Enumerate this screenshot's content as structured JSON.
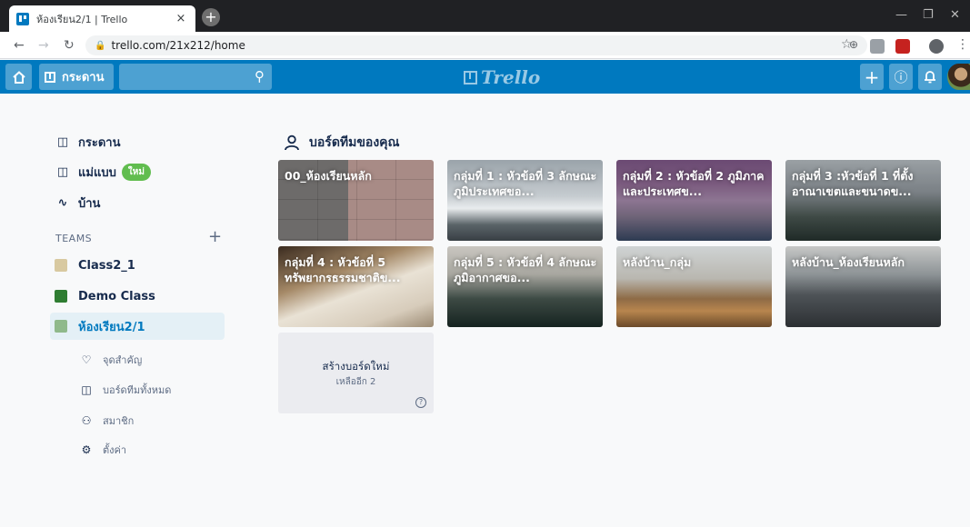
{
  "browser": {
    "tab_title": "ห้องเรียน2/1 | Trello",
    "tab_close": "×",
    "new_tab": "+",
    "url": "trello.com/21x212/home",
    "window_controls": {
      "minimize": "—",
      "restore": "❐",
      "close": "✕"
    }
  },
  "header": {
    "home_icon": "home-icon",
    "boards_label": "กระดาน",
    "search_value": "",
    "logo_text": "Trello",
    "add_label": "+",
    "info_label": "ⓘ",
    "accent": "#0079bf"
  },
  "sidebar": {
    "items": [
      {
        "icon": "board-icon",
        "label": "กระดาน"
      },
      {
        "icon": "template-icon",
        "label": "แม่แบบ",
        "badge": "ใหม่"
      },
      {
        "icon": "pulse-icon",
        "label": "บ้าน"
      }
    ],
    "teams_label": "TEAMS",
    "teams": [
      {
        "label": "Class2_1"
      },
      {
        "label": "Demo Class"
      },
      {
        "label": "ห้องเรียน2/1"
      }
    ],
    "team_sub_items": [
      {
        "icon": "heart-icon",
        "label": "จุดสำคัญ"
      },
      {
        "icon": "board-icon",
        "label": "บอร์ดทีมทั้งหมด"
      },
      {
        "icon": "members-icon",
        "label": "สมาชิก"
      },
      {
        "icon": "gear-icon",
        "label": "ตั้งค่า"
      }
    ]
  },
  "main": {
    "section_title": "บอร์ดทีมของคุณ",
    "boards": [
      {
        "title": "00_ห้องเรียนหลัก"
      },
      {
        "title": "กลุ่มที่ 1 : หัวข้อที่ 3 ลักษณะภูมิประเทศขอ..."
      },
      {
        "title": "กลุ่มที่ 2 : หัวข้อที่ 2 ภูมิภาคและประเทศข..."
      },
      {
        "title": "กลุ่มที่ 3 :หัวข้อที่ 1 ที่ตั้ง อาณาเขตและขนาดข..."
      },
      {
        "title": "กลุ่มที่ 4 : หัวข้อที่ 5 ทรัพยากรธรรมชาติข..."
      },
      {
        "title": "กลุ่มที่ 5 : หัวข้อที่ 4 ลักษณะภูมิอากาศขอ..."
      },
      {
        "title": "หลังบ้าน_กลุ่ม"
      },
      {
        "title": "หลังบ้าน_ห้องเรียนหลัก"
      }
    ],
    "create_board": {
      "title": "สร้างบอร์ดใหม่",
      "remaining": "เหลืออีก 2",
      "help": "?"
    }
  }
}
